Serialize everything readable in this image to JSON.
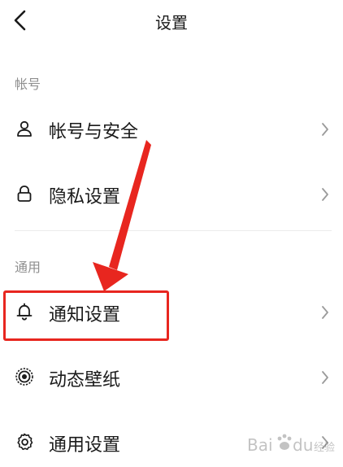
{
  "header": {
    "back_icon": "chevron-left-icon",
    "title": "设置"
  },
  "sections": {
    "account": {
      "title": "帐号",
      "items": [
        {
          "label": "帐号与安全",
          "icon": "user-icon"
        },
        {
          "label": "隐私设置",
          "icon": "lock-icon"
        }
      ]
    },
    "general": {
      "title": "通用",
      "items": [
        {
          "label": "通知设置",
          "icon": "bell-icon"
        },
        {
          "label": "动态壁纸",
          "icon": "dynamic-wallpaper-icon"
        },
        {
          "label": "通用设置",
          "icon": "gear-icon"
        }
      ]
    }
  },
  "annotation": {
    "highlight_color": "#e8261f",
    "highlighted_item": "通知设置"
  },
  "watermark": {
    "text": "Bai du 经验",
    "logo": "baidu-paw-icon"
  }
}
